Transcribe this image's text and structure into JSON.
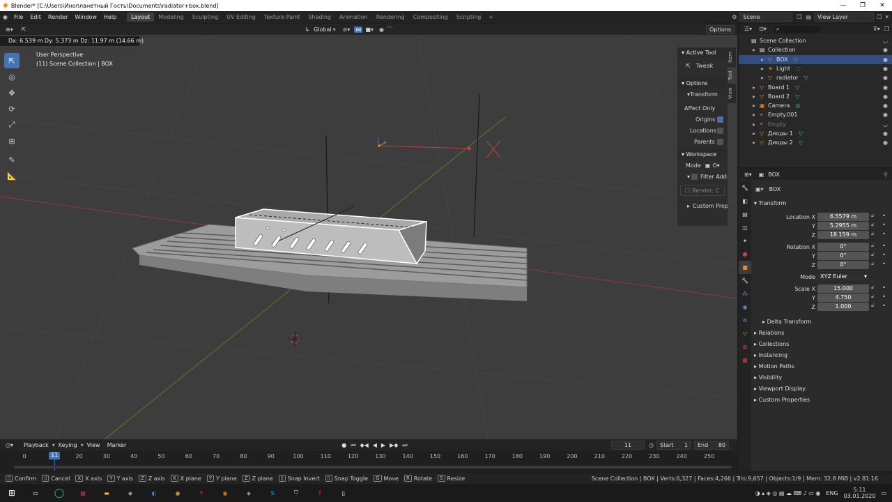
{
  "window": {
    "title": "Blender* [C:\\Users\\Инопланетный Гость\\Documents\\radiator+box.blend]"
  },
  "menu": [
    "File",
    "Edit",
    "Render",
    "Window",
    "Help"
  ],
  "workspaces": [
    "Layout",
    "Modeling",
    "Sculpting",
    "UV Editing",
    "Texture Paint",
    "Shading",
    "Animation",
    "Rendering",
    "Compositing",
    "Scripting"
  ],
  "scene": {
    "name": "Scene",
    "view_layer": "View Layer"
  },
  "header": {
    "orientation": "Global",
    "options": "Options"
  },
  "viewport": {
    "delta": "Dx: 6.539 m   Dy: 5.373 m  Dz: 11.97 m (14.66 m)",
    "perspective": "User Perspective",
    "collection_info": "(11) Scene Collection | BOX",
    "axis_y": "Y"
  },
  "npanel": {
    "active_tool": "Active Tool",
    "tool_name": "Tweak",
    "options": "Options",
    "transform": "Transform",
    "affect_only": "Affect Only",
    "origins": "Origins",
    "locations": "Locations",
    "parents": "Parents",
    "workspace": "Workspace",
    "mode": "Mode",
    "mode_value": "O",
    "filter_add": "Filter Add-",
    "render_c": "Render: C",
    "custom_props": "Custom Proper",
    "tabs": [
      "Item",
      "Tool",
      "View"
    ]
  },
  "outliner": {
    "rows": [
      {
        "name": "Scene Collection",
        "indent": 0,
        "icon": "collection",
        "selected": false,
        "eye": false
      },
      {
        "name": "Collection",
        "indent": 1,
        "icon": "collection",
        "selected": false,
        "eye": true
      },
      {
        "name": "BOX",
        "indent": 2,
        "icon": "mesh",
        "selected": true,
        "eye": true
      },
      {
        "name": "Light",
        "indent": 2,
        "icon": "light",
        "selected": false,
        "eye": true
      },
      {
        "name": "radiator",
        "indent": 2,
        "icon": "mesh",
        "selected": false,
        "eye": true
      },
      {
        "name": "Board 1",
        "indent": 1,
        "icon": "mesh",
        "selected": false,
        "eye": true
      },
      {
        "name": "Board 2",
        "indent": 1,
        "icon": "mesh",
        "selected": false,
        "eye": true
      },
      {
        "name": "Camera",
        "indent": 1,
        "icon": "camera",
        "selected": false,
        "eye": true
      },
      {
        "name": "Empty.001",
        "indent": 1,
        "icon": "empty",
        "selected": false,
        "eye": true
      },
      {
        "name": "Empty",
        "indent": 1,
        "icon": "empty",
        "selected": false,
        "eye": false
      },
      {
        "name": "Диоды 1",
        "indent": 1,
        "icon": "mesh",
        "selected": false,
        "eye": true
      },
      {
        "name": "Диоды 2",
        "indent": 1,
        "icon": "mesh",
        "selected": false,
        "eye": true
      }
    ]
  },
  "properties": {
    "object": "BOX",
    "object_name": "BOX",
    "transform": "Transform",
    "location_x_label": "Location X",
    "rotation_x_label": "Rotation X",
    "scale_x_label": "Scale X",
    "y_label": "Y",
    "z_label": "Z",
    "mode_label": "Mode",
    "location": [
      "6.5579 m",
      "5.2955 m",
      "18.159 m"
    ],
    "rotation": [
      "0°",
      "0°",
      "0°"
    ],
    "rotation_mode": "XYZ Euler",
    "scale": [
      "15.000",
      "4.750",
      "1.000"
    ],
    "delta_transform": "Delta Transform",
    "sections": [
      "Relations",
      "Collections",
      "Instancing",
      "Motion Paths",
      "Visibility",
      "Viewport Display",
      "Custom Properties"
    ]
  },
  "timeline": {
    "playback": "Playback",
    "keying": "Keying",
    "view": "View",
    "marker": "Marker",
    "current_frame": "11",
    "start_label": "Start",
    "start": "1",
    "end_label": "End",
    "end": "80",
    "ticks": [
      "0",
      "10",
      "20",
      "30",
      "40",
      "50",
      "60",
      "70",
      "80",
      "90",
      "100",
      "110",
      "120",
      "130",
      "140",
      "150",
      "160",
      "170",
      "180",
      "190",
      "200",
      "210",
      "220",
      "230",
      "240",
      "250"
    ]
  },
  "statusbar": {
    "items": [
      {
        "key": "",
        "label": "Confirm"
      },
      {
        "key": "",
        "label": "Cancel"
      },
      {
        "key": "X",
        "label": "X axis"
      },
      {
        "key": "Y",
        "label": "Y axis"
      },
      {
        "key": "Z",
        "label": "Z axis"
      },
      {
        "key": "X",
        "label": "X plane"
      },
      {
        "key": "Y",
        "label": "Y plane"
      },
      {
        "key": "Z",
        "label": "Z plane"
      },
      {
        "key": "",
        "label": "Snap Invert"
      },
      {
        "key": "",
        "label": "Snap Toggle"
      },
      {
        "key": "G",
        "label": "Move"
      },
      {
        "key": "R",
        "label": "Rotate"
      },
      {
        "key": "S",
        "label": "Resize"
      }
    ],
    "info": "Scene Collection | BOX | Verts:6,327 | Faces:4,266 | Tris:9,657 | Objects:1/9 | Mem: 32.8 MiB | v2.81.16"
  },
  "taskbar": {
    "lang": "ENG",
    "time": "5:11",
    "date": "03.01.2020"
  },
  "colors": {
    "accent": "#4772b3",
    "selected_row": "#334d80",
    "x_axis": "#b03a3a",
    "y_axis": "#7a9a28",
    "outline": "#f0a030",
    "mesh_icon": "#e08a2a",
    "data_icon": "#3fb8a0"
  }
}
